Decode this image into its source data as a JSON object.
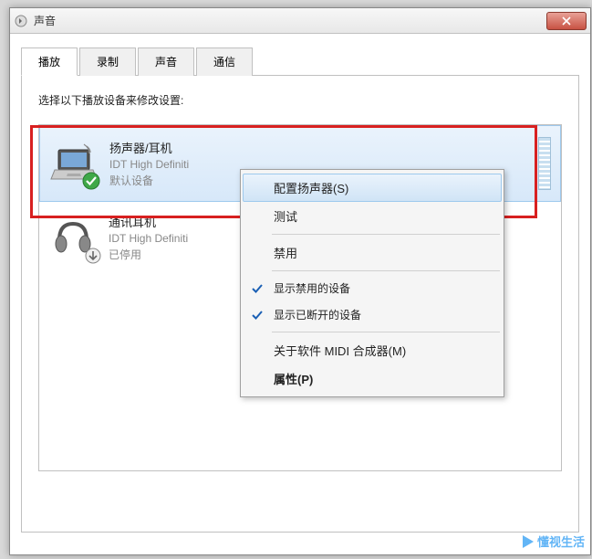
{
  "window": {
    "title": "声音"
  },
  "tabs": [
    {
      "label": "播放",
      "active": true
    },
    {
      "label": "录制",
      "active": false
    },
    {
      "label": "声音",
      "active": false
    },
    {
      "label": "通信",
      "active": false
    }
  ],
  "instruction": "选择以下播放设备来修改设置:",
  "devices": [
    {
      "name": "扬声器/耳机",
      "driver": "IDT High Definiti",
      "status": "默认设备",
      "selected": true,
      "icon": "laptop"
    },
    {
      "name": "通讯耳机",
      "driver": "IDT High Definiti",
      "status": "已停用",
      "selected": false,
      "icon": "headphones"
    }
  ],
  "contextMenu": {
    "items": [
      {
        "label": "配置扬声器(S)",
        "type": "item",
        "hover": true
      },
      {
        "label": "测试",
        "type": "item"
      },
      {
        "type": "separator"
      },
      {
        "label": "禁用",
        "type": "item"
      },
      {
        "type": "separator"
      },
      {
        "label": "显示禁用的设备",
        "type": "item",
        "checked": true
      },
      {
        "label": "显示已断开的设备",
        "type": "item",
        "checked": true
      },
      {
        "type": "separator"
      },
      {
        "label": "关于软件 MIDI 合成器(M)",
        "type": "item"
      },
      {
        "label": "属性(P)",
        "type": "item",
        "bold": true
      }
    ]
  },
  "watermark": "懂视生活"
}
